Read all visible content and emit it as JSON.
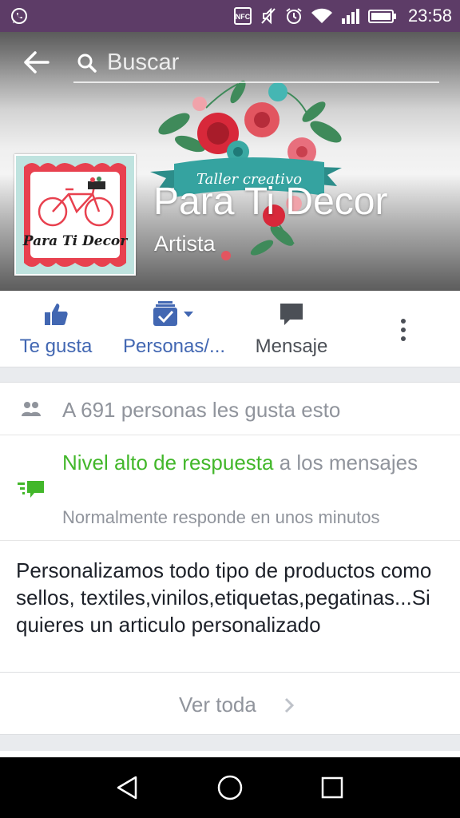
{
  "status_bar": {
    "time": "23:58",
    "icons": [
      "whatsapp-icon",
      "nfc-icon",
      "mute-icon",
      "alarm-icon",
      "wifi-icon",
      "signal-icon",
      "battery-icon"
    ],
    "color": "#5d3c67"
  },
  "search": {
    "placeholder": "Buscar"
  },
  "page": {
    "name": "Para Ti Decor",
    "category": "Artista",
    "cover_banner_text": "Taller creativo",
    "logo_text": "Para Ti Decor"
  },
  "actions": {
    "like_label": "Te gusta",
    "follow_label": "Personas/...",
    "message_label": "Mensaje",
    "accent": "#4267b2"
  },
  "info": {
    "likes_text": "A 691 personas les gusta esto",
    "response_highlight": "Nivel alto de respuesta",
    "response_rest": " a los mensajes",
    "response_sub": "Normalmente responde en unos minutos",
    "description": "Personalizamos todo tipo de productos como sellos, textiles,vinilos,etiquetas,pegatinas...Si quieres un articulo personalizado",
    "highlight_color": "#42b72a"
  },
  "see_all": {
    "label": "Ver toda"
  },
  "nav_bar": {
    "icons": [
      "back-triangle-icon",
      "home-circle-icon",
      "recent-apps-square-icon"
    ]
  }
}
